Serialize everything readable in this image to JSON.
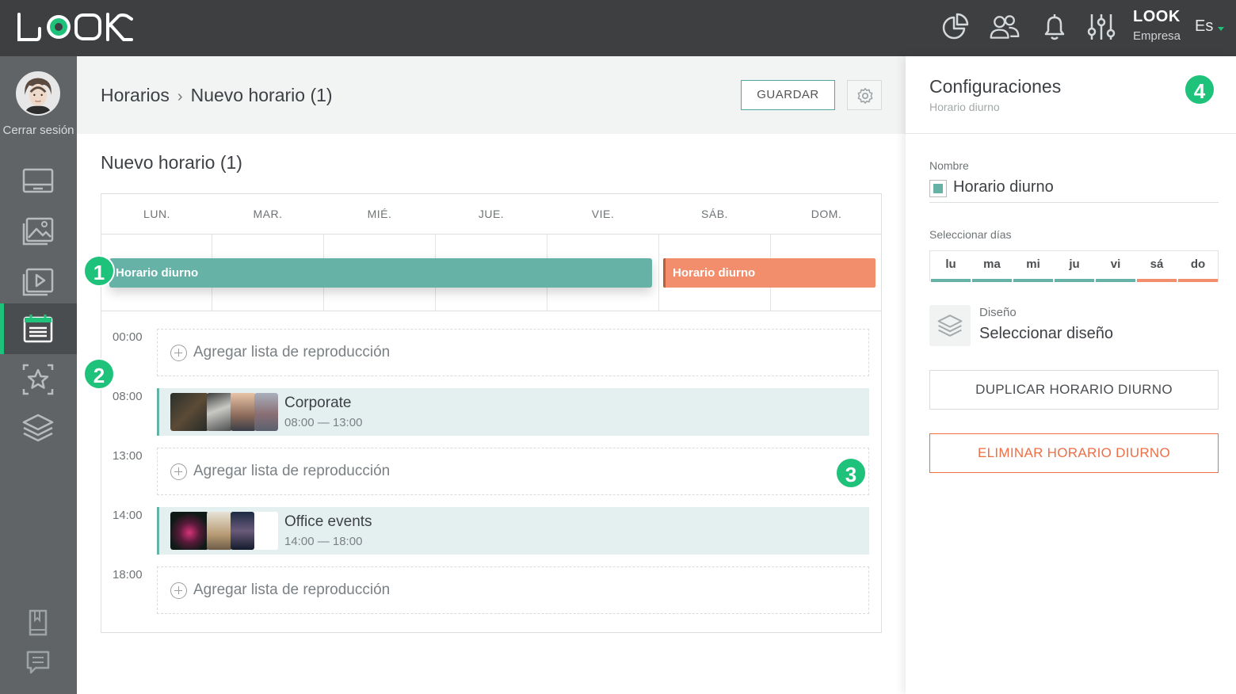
{
  "app": {
    "logo_text": "LOOK"
  },
  "topbar": {
    "icons": [
      "chart-pie-icon",
      "users-icon",
      "bell-icon",
      "sliders-icon"
    ],
    "user_name": "LOOK",
    "user_role": "Empresa",
    "language": "Es"
  },
  "sidebar": {
    "logout_label": "Cerrar sesión",
    "items": [
      {
        "icon": "monitor-icon",
        "active": false
      },
      {
        "icon": "image-icon",
        "active": false
      },
      {
        "icon": "video-icon",
        "active": false
      },
      {
        "icon": "calendar-icon",
        "active": true
      },
      {
        "icon": "star-icon",
        "active": false
      },
      {
        "icon": "layers-icon",
        "active": false
      }
    ],
    "bottom_icons": [
      "book-icon",
      "chat-icon"
    ]
  },
  "header": {
    "breadcrumb_root": "Horarios",
    "breadcrumb_current": "Nuevo horario (1)",
    "save_label": "GUARDAR"
  },
  "schedule": {
    "title": "Nuevo horario (1)",
    "days": [
      "LUN.",
      "MAR.",
      "MIÉ.",
      "JUE.",
      "VIE.",
      "SÁB.",
      "DOM."
    ],
    "bars": [
      {
        "label": "Horario diurno",
        "color": "#66b2a6",
        "days": "LUN.-VIE."
      },
      {
        "label": "Horario diurno",
        "color": "#f28e6c",
        "days": "SÁB.-DOM."
      }
    ],
    "slots": [
      {
        "time": "00:00",
        "type": "empty",
        "label": "Agregar lista de reproducción"
      },
      {
        "time": "08:00",
        "type": "playlist",
        "name": "Corporate",
        "range": "08:00 — 13:00"
      },
      {
        "time": "13:00",
        "type": "empty",
        "label": "Agregar lista de reproducción"
      },
      {
        "time": "14:00",
        "type": "playlist",
        "name": "Office events",
        "range": "14:00 — 18:00"
      },
      {
        "time": "18:00",
        "type": "empty",
        "label": "Agregar lista de reproducción"
      }
    ]
  },
  "badges": [
    "1",
    "2",
    "3",
    "4"
  ],
  "panel": {
    "title": "Configuraciones",
    "subtitle": "Horario diurno",
    "name_label": "Nombre",
    "name_value": "Horario diurno",
    "name_color": "#66b2a6",
    "days_label": "Seleccionar días",
    "day_options": [
      {
        "label": "lu",
        "color": "#66b2a6"
      },
      {
        "label": "ma",
        "color": "#66b2a6"
      },
      {
        "label": "mi",
        "color": "#66b2a6"
      },
      {
        "label": "ju",
        "color": "#66b2a6"
      },
      {
        "label": "vi",
        "color": "#66b2a6"
      },
      {
        "label": "sá",
        "color": "#f28e6c"
      },
      {
        "label": "do",
        "color": "#f28e6c"
      }
    ],
    "design_label": "Diseño",
    "design_value": "Seleccionar diseño",
    "duplicate_label": "DUPLICAR HORARIO DIURNO",
    "delete_label": "ELIMINAR HORARIO DIURNO"
  },
  "colors": {
    "accent": "#1fc27a",
    "teal": "#66b2a6",
    "orange": "#f28e6c",
    "danger": "#ef6f45"
  }
}
